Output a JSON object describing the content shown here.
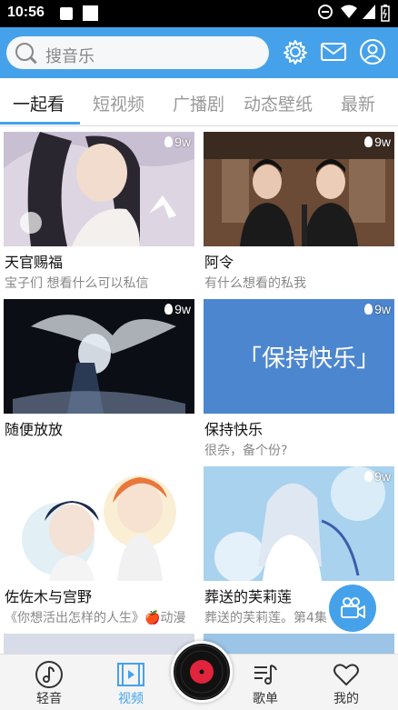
{
  "status_bar": {
    "time": "10:56"
  },
  "search": {
    "placeholder": "搜音乐"
  },
  "tabs": [
    {
      "label": "一起看",
      "active": true
    },
    {
      "label": "短视频"
    },
    {
      "label": "广播剧"
    },
    {
      "label": "动态壁纸"
    },
    {
      "label": "最新"
    }
  ],
  "cards": [
    {
      "title": "天官赐福",
      "subtitle": "宝子们 想看什么可以私信",
      "views": "9w"
    },
    {
      "title": "阿令",
      "subtitle": "有什么想看的私我",
      "views": "9w"
    },
    {
      "title": "随便放放",
      "subtitle": "",
      "views": "9w"
    },
    {
      "title": "保持快乐",
      "subtitle": "很杂，备个份?",
      "views": "9w",
      "thumb_text": "「保持快乐」"
    },
    {
      "title": "佐佐木与宫野",
      "subtitle": "《你想活出怎样的人生》🍎动漫",
      "views": ""
    },
    {
      "title": "葬送的芙莉莲",
      "subtitle": "葬送的芙莉莲。第4集",
      "views": "9w"
    }
  ],
  "bottom_nav": [
    {
      "label": "轻音",
      "icon": "music-note-icon"
    },
    {
      "label": "视频",
      "icon": "video-icon",
      "active": true
    },
    {
      "label": "歌单",
      "icon": "playlist-icon"
    },
    {
      "label": "我的",
      "icon": "heart-icon"
    }
  ],
  "colors": {
    "accent": "#45a2ea",
    "record_red": "#e0243c"
  }
}
